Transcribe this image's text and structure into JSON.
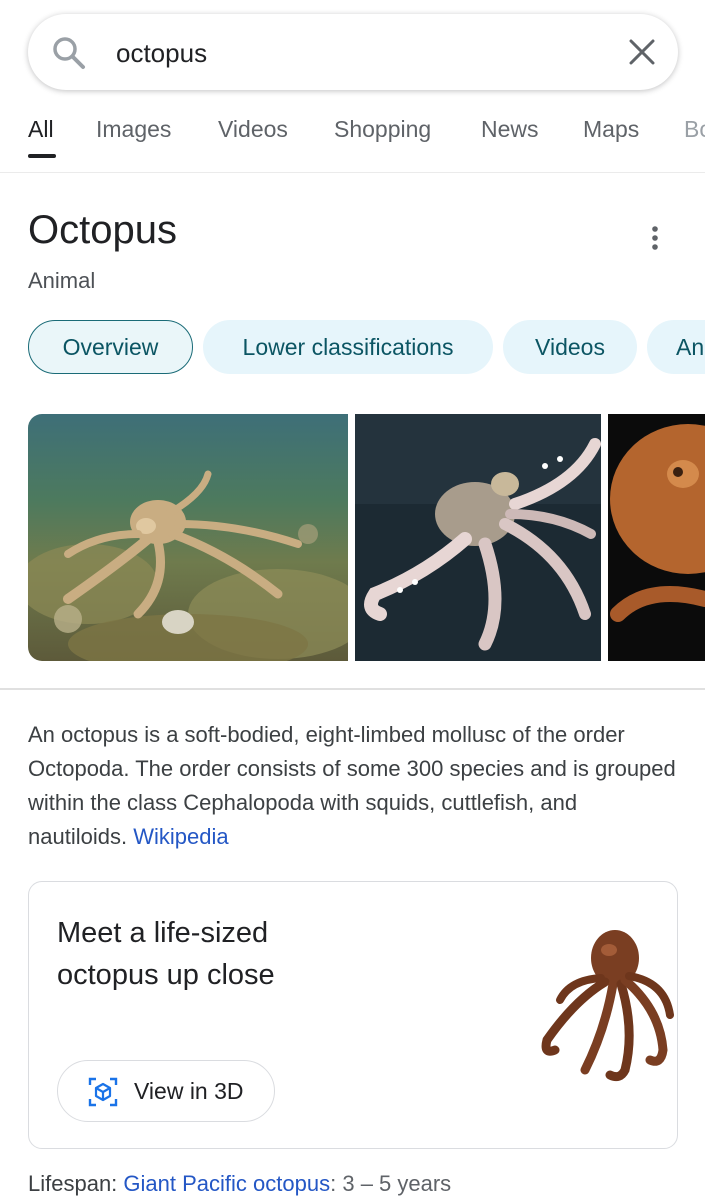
{
  "search": {
    "query": "octopus"
  },
  "tabs": [
    {
      "label": "All"
    },
    {
      "label": "Images"
    },
    {
      "label": "Videos"
    },
    {
      "label": "Shopping"
    },
    {
      "label": "News"
    },
    {
      "label": "Maps"
    },
    {
      "label": "Bo"
    }
  ],
  "panel": {
    "title": "Octopus",
    "subtitle": "Animal",
    "chips": [
      {
        "label": "Overview"
      },
      {
        "label": "Lower classifications"
      },
      {
        "label": "Videos"
      },
      {
        "label": "An"
      }
    ],
    "description": "An octopus is a soft-bodied, eight-limbed mollusc of the order Octopoda. The order consists of some 300 species and is grouped within the class Cephalopoda with squids, cuttlefish, and nautiloids.",
    "source_link": "Wikipedia"
  },
  "card_3d": {
    "title": "Meet a life-sized octopus up close",
    "button_label": "View in 3D"
  },
  "lifespan": {
    "label": "Lifespan:",
    "link": "Giant Pacific octopus",
    "separator": ":",
    "value": "3 – 5 years"
  },
  "colors": {
    "chip_bg": "#e6f5fb",
    "chip_text": "#0b5563",
    "link": "#2457c5"
  },
  "icons": [
    "search-icon",
    "close-icon",
    "more-vert-icon",
    "3d-cube-icon"
  ]
}
